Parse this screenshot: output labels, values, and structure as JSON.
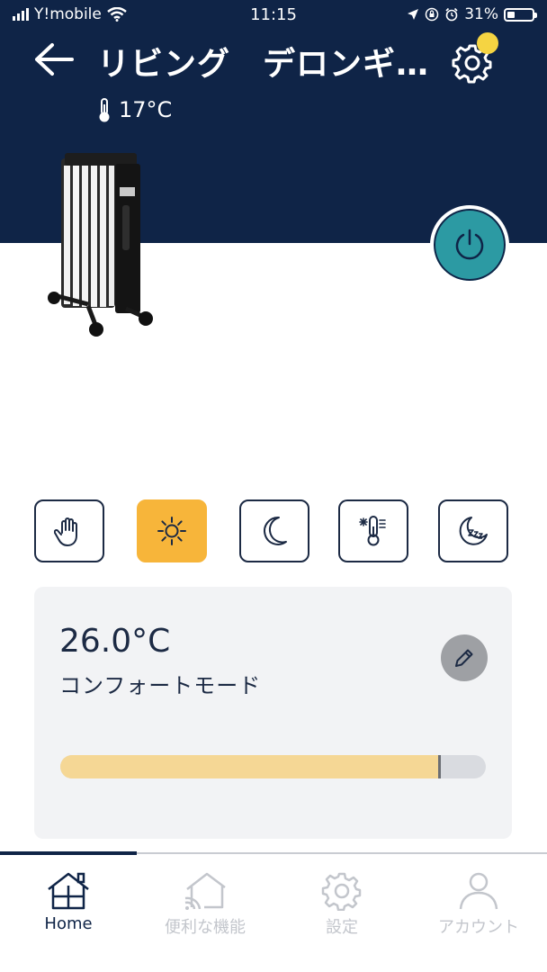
{
  "status_bar": {
    "carrier": "Y!mobile",
    "time": "11:15",
    "battery": "31%",
    "battery_level": 0.31
  },
  "header": {
    "back_icon": "arrow-left-icon",
    "room": "リビング",
    "device": "デロンギ…",
    "settings_icon": "gear-icon",
    "notification_color": "#f5d442",
    "current_temperature": "17°C",
    "background_color": "#0f2447"
  },
  "power": {
    "icon": "power-icon",
    "color": "#2c9aa3"
  },
  "modes": [
    {
      "id": "manual",
      "icon": "hand-icon",
      "active": false
    },
    {
      "id": "comfort",
      "icon": "sun-icon",
      "active": true
    },
    {
      "id": "eco",
      "icon": "moon-icon",
      "active": false
    },
    {
      "id": "antifreeze",
      "icon": "thermometer-snow-icon",
      "active": false
    },
    {
      "id": "sleep",
      "icon": "sleep-icon",
      "active": false
    }
  ],
  "mode_active_color": "#f7b53a",
  "setpoint_card": {
    "temperature": "26.0°C",
    "mode_label": "コンフォートモード",
    "edit_icon": "pencil-icon",
    "slider_level": 0.89
  },
  "bottom_nav": {
    "items": [
      {
        "label": "Home",
        "icon": "home-icon",
        "active": true
      },
      {
        "label": "便利な機能",
        "icon": "smart-home-icon",
        "active": false
      },
      {
        "label": "設定",
        "icon": "gear-icon",
        "active": false
      },
      {
        "label": "アカウント",
        "icon": "person-icon",
        "active": false
      }
    ]
  }
}
